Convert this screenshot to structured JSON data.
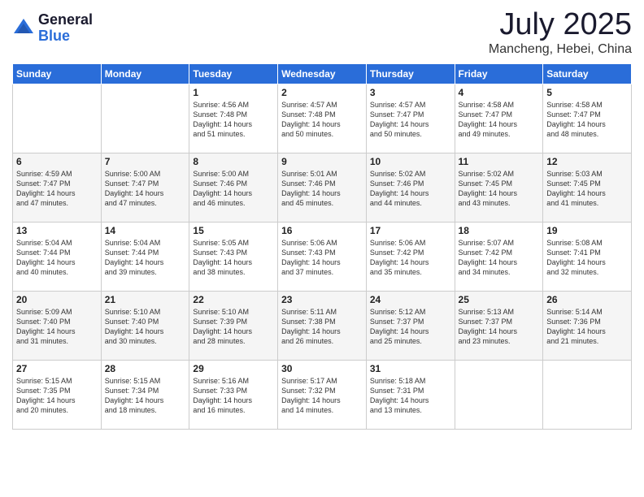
{
  "logo": {
    "general": "General",
    "blue": "Blue"
  },
  "title": "July 2025",
  "location": "Mancheng, Hebei, China",
  "days_of_week": [
    "Sunday",
    "Monday",
    "Tuesday",
    "Wednesday",
    "Thursday",
    "Friday",
    "Saturday"
  ],
  "weeks": [
    [
      {
        "day": "",
        "info": ""
      },
      {
        "day": "",
        "info": ""
      },
      {
        "day": "1",
        "info": "Sunrise: 4:56 AM\nSunset: 7:48 PM\nDaylight: 14 hours\nand 51 minutes."
      },
      {
        "day": "2",
        "info": "Sunrise: 4:57 AM\nSunset: 7:48 PM\nDaylight: 14 hours\nand 50 minutes."
      },
      {
        "day": "3",
        "info": "Sunrise: 4:57 AM\nSunset: 7:47 PM\nDaylight: 14 hours\nand 50 minutes."
      },
      {
        "day": "4",
        "info": "Sunrise: 4:58 AM\nSunset: 7:47 PM\nDaylight: 14 hours\nand 49 minutes."
      },
      {
        "day": "5",
        "info": "Sunrise: 4:58 AM\nSunset: 7:47 PM\nDaylight: 14 hours\nand 48 minutes."
      }
    ],
    [
      {
        "day": "6",
        "info": "Sunrise: 4:59 AM\nSunset: 7:47 PM\nDaylight: 14 hours\nand 47 minutes."
      },
      {
        "day": "7",
        "info": "Sunrise: 5:00 AM\nSunset: 7:47 PM\nDaylight: 14 hours\nand 47 minutes."
      },
      {
        "day": "8",
        "info": "Sunrise: 5:00 AM\nSunset: 7:46 PM\nDaylight: 14 hours\nand 46 minutes."
      },
      {
        "day": "9",
        "info": "Sunrise: 5:01 AM\nSunset: 7:46 PM\nDaylight: 14 hours\nand 45 minutes."
      },
      {
        "day": "10",
        "info": "Sunrise: 5:02 AM\nSunset: 7:46 PM\nDaylight: 14 hours\nand 44 minutes."
      },
      {
        "day": "11",
        "info": "Sunrise: 5:02 AM\nSunset: 7:45 PM\nDaylight: 14 hours\nand 43 minutes."
      },
      {
        "day": "12",
        "info": "Sunrise: 5:03 AM\nSunset: 7:45 PM\nDaylight: 14 hours\nand 41 minutes."
      }
    ],
    [
      {
        "day": "13",
        "info": "Sunrise: 5:04 AM\nSunset: 7:44 PM\nDaylight: 14 hours\nand 40 minutes."
      },
      {
        "day": "14",
        "info": "Sunrise: 5:04 AM\nSunset: 7:44 PM\nDaylight: 14 hours\nand 39 minutes."
      },
      {
        "day": "15",
        "info": "Sunrise: 5:05 AM\nSunset: 7:43 PM\nDaylight: 14 hours\nand 38 minutes."
      },
      {
        "day": "16",
        "info": "Sunrise: 5:06 AM\nSunset: 7:43 PM\nDaylight: 14 hours\nand 37 minutes."
      },
      {
        "day": "17",
        "info": "Sunrise: 5:06 AM\nSunset: 7:42 PM\nDaylight: 14 hours\nand 35 minutes."
      },
      {
        "day": "18",
        "info": "Sunrise: 5:07 AM\nSunset: 7:42 PM\nDaylight: 14 hours\nand 34 minutes."
      },
      {
        "day": "19",
        "info": "Sunrise: 5:08 AM\nSunset: 7:41 PM\nDaylight: 14 hours\nand 32 minutes."
      }
    ],
    [
      {
        "day": "20",
        "info": "Sunrise: 5:09 AM\nSunset: 7:40 PM\nDaylight: 14 hours\nand 31 minutes."
      },
      {
        "day": "21",
        "info": "Sunrise: 5:10 AM\nSunset: 7:40 PM\nDaylight: 14 hours\nand 30 minutes."
      },
      {
        "day": "22",
        "info": "Sunrise: 5:10 AM\nSunset: 7:39 PM\nDaylight: 14 hours\nand 28 minutes."
      },
      {
        "day": "23",
        "info": "Sunrise: 5:11 AM\nSunset: 7:38 PM\nDaylight: 14 hours\nand 26 minutes."
      },
      {
        "day": "24",
        "info": "Sunrise: 5:12 AM\nSunset: 7:37 PM\nDaylight: 14 hours\nand 25 minutes."
      },
      {
        "day": "25",
        "info": "Sunrise: 5:13 AM\nSunset: 7:37 PM\nDaylight: 14 hours\nand 23 minutes."
      },
      {
        "day": "26",
        "info": "Sunrise: 5:14 AM\nSunset: 7:36 PM\nDaylight: 14 hours\nand 21 minutes."
      }
    ],
    [
      {
        "day": "27",
        "info": "Sunrise: 5:15 AM\nSunset: 7:35 PM\nDaylight: 14 hours\nand 20 minutes."
      },
      {
        "day": "28",
        "info": "Sunrise: 5:15 AM\nSunset: 7:34 PM\nDaylight: 14 hours\nand 18 minutes."
      },
      {
        "day": "29",
        "info": "Sunrise: 5:16 AM\nSunset: 7:33 PM\nDaylight: 14 hours\nand 16 minutes."
      },
      {
        "day": "30",
        "info": "Sunrise: 5:17 AM\nSunset: 7:32 PM\nDaylight: 14 hours\nand 14 minutes."
      },
      {
        "day": "31",
        "info": "Sunrise: 5:18 AM\nSunset: 7:31 PM\nDaylight: 14 hours\nand 13 minutes."
      },
      {
        "day": "",
        "info": ""
      },
      {
        "day": "",
        "info": ""
      }
    ]
  ]
}
